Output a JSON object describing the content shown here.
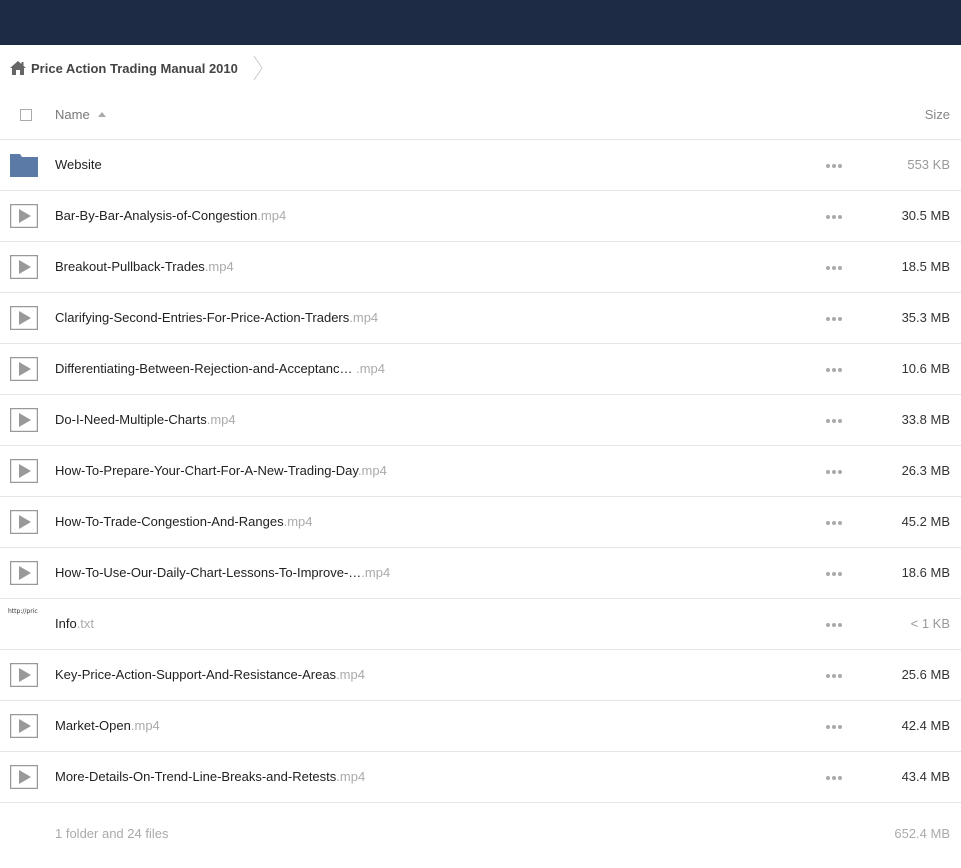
{
  "breadcrumb": {
    "folder": "Price Action Trading Manual 2010"
  },
  "header": {
    "name_label": "Name",
    "size_label": "Size"
  },
  "files": [
    {
      "kind": "folder",
      "base": "Website",
      "ext": "",
      "size": "553 KB"
    },
    {
      "kind": "video",
      "base": "Bar-By-Bar-Analysis-of-Congestion",
      "ext": ".mp4",
      "size": "30.5 MB"
    },
    {
      "kind": "video",
      "base": "Breakout-Pullback-Trades",
      "ext": ".mp4",
      "size": "18.5 MB"
    },
    {
      "kind": "video",
      "base": "Clarifying-Second-Entries-For-Price-Action-Traders",
      "ext": ".mp4",
      "size": "35.3 MB"
    },
    {
      "kind": "video",
      "base": "Differentiating-Between-Rejection-and-Acceptanc…  ",
      "ext": ".mp4",
      "size": "10.6 MB"
    },
    {
      "kind": "video",
      "base": "Do-I-Need-Multiple-Charts",
      "ext": ".mp4",
      "size": "33.8 MB"
    },
    {
      "kind": "video",
      "base": "How-To-Prepare-Your-Chart-For-A-New-Trading-Day",
      "ext": ".mp4",
      "size": "26.3 MB"
    },
    {
      "kind": "video",
      "base": "How-To-Trade-Congestion-And-Ranges",
      "ext": ".mp4",
      "size": "45.2 MB"
    },
    {
      "kind": "video",
      "base": "How-To-Use-Our-Daily-Chart-Lessons-To-Improve-…",
      "ext": ".mp4",
      "size": "18.6 MB"
    },
    {
      "kind": "text",
      "base": "Info",
      "ext": ".txt",
      "size": "< 1 KB",
      "thumb": "http://pric"
    },
    {
      "kind": "video",
      "base": "Key-Price-Action-Support-And-Resistance-Areas",
      "ext": ".mp4",
      "size": "25.6 MB"
    },
    {
      "kind": "video",
      "base": "Market-Open",
      "ext": ".mp4",
      "size": "42.4 MB"
    },
    {
      "kind": "video",
      "base": "More-Details-On-Trend-Line-Breaks-and-Retests",
      "ext": ".mp4",
      "size": "43.4 MB"
    }
  ],
  "summary": {
    "count": "1 folder and 24 files",
    "total": "652.4 MB"
  },
  "colors": {
    "topbar": "#1e2b45",
    "folder": "#5b7aa6",
    "icon_gray": "#999999"
  }
}
